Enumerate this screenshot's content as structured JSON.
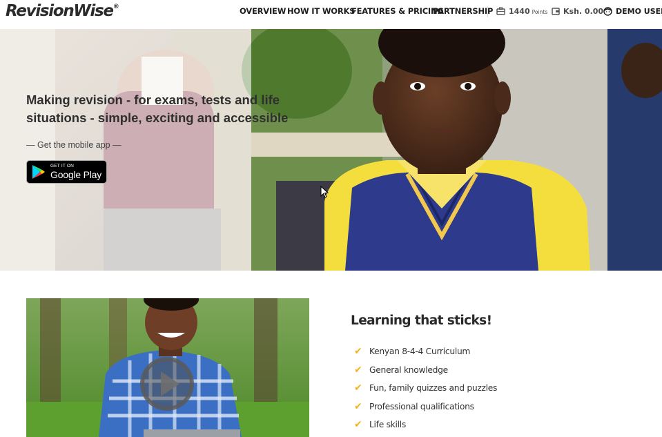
{
  "brand": {
    "name": "RevisionWise",
    "mark": "®"
  },
  "nav": {
    "overview": "OVERVIEW",
    "how_it_works": "HOW IT WORKS",
    "features_pricing": "FEATURES & PRICING",
    "partnership": "PARTNERSHIP"
  },
  "account": {
    "points_value": "1440",
    "points_unit": "Points",
    "balance": "Ksh. 0.00",
    "user": "DEMO USER"
  },
  "hero": {
    "headline": "Making revision - for exams, tests and life situations - simple, exciting and accessible",
    "app_prompt": "— Get the mobile app —",
    "store_badge": {
      "small": "GET IT ON",
      "big": "Google Play"
    }
  },
  "learning": {
    "title": "Learning that sticks!",
    "items": [
      "Kenyan 8-4-4 Curriculum",
      "General knowledge",
      "Fun, family quizzes and puzzles",
      "Professional qualifications",
      "Life skills"
    ]
  },
  "icons": {
    "points": "briefcase-icon",
    "balance": "wallet-icon",
    "user": "user-face-icon",
    "check": "checkmark-icon",
    "play": "play-icon",
    "store": "google-play-icon"
  },
  "colors": {
    "accent_check": "#f5b21b",
    "text_dark": "#1e1e1e"
  }
}
